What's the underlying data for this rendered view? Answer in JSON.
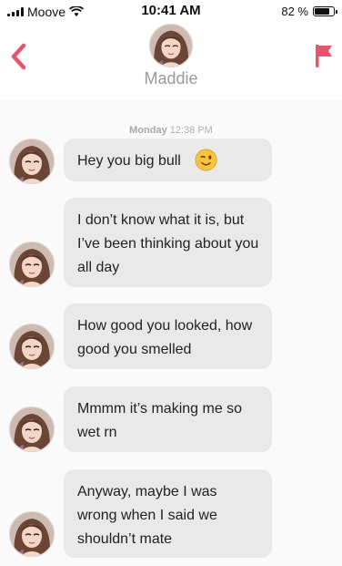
{
  "status_bar": {
    "carrier": "Moove",
    "time": "10:41 AM",
    "battery": "82 %",
    "battery_level": 0.82
  },
  "header": {
    "contact_name": "Maddie",
    "back_icon": "chevron-left-icon",
    "report_icon": "flag-icon",
    "accent_color": "#e5566b"
  },
  "chat": {
    "timestamp_day": "Monday",
    "timestamp_time": "12:38 PM",
    "messages": [
      {
        "text": "Hey you big bull",
        "emoji": "winking-face-icon"
      },
      {
        "text": "I don’t know what it is, but I’ve been thinking about you all day"
      },
      {
        "text": "How good you looked, how good you smelled"
      },
      {
        "text": "Mmmm it’s making me so wet rn"
      },
      {
        "text": "Anyway, maybe I was wrong when I said we shouldn’t mate"
      }
    ]
  }
}
